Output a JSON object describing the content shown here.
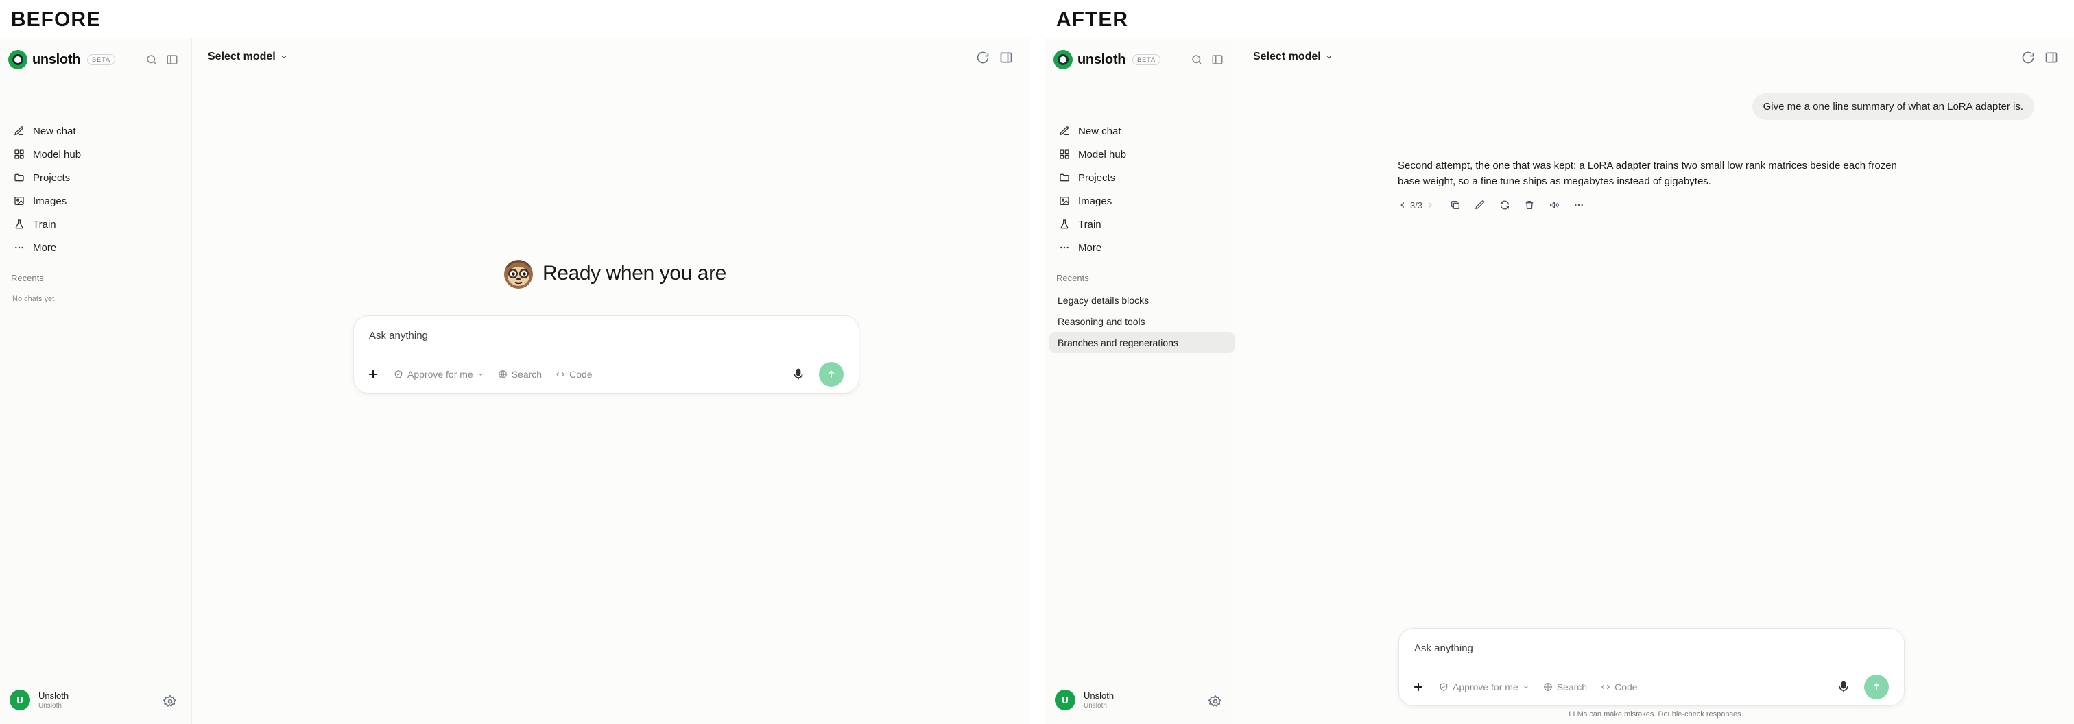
{
  "labels": {
    "before": "BEFORE",
    "after": "AFTER"
  },
  "brand": {
    "name": "unsloth",
    "badge": "BETA"
  },
  "nav": [
    {
      "label": "New chat",
      "icon": "edit-icon"
    },
    {
      "label": "Model hub",
      "icon": "grid-icon"
    },
    {
      "label": "Projects",
      "icon": "folder-icon"
    },
    {
      "label": "Images",
      "icon": "image-icon"
    },
    {
      "label": "Train",
      "icon": "flask-icon"
    },
    {
      "label": "More",
      "icon": "more-icon"
    }
  ],
  "recents": {
    "title": "Recents",
    "empty": "No chats yet",
    "items": [
      "Legacy details blocks",
      "Reasoning and tools",
      "Branches and regenerations"
    ],
    "active_index": 2
  },
  "user": {
    "initial": "U",
    "name": "Unsloth",
    "sub": "Unsloth"
  },
  "header": {
    "model_select": "Select model"
  },
  "hero": {
    "text": "Ready when you are"
  },
  "composer": {
    "placeholder": "Ask anything",
    "approve": "Approve for me",
    "search": "Search",
    "code": "Code"
  },
  "conversation": {
    "user_message": "Give me a one line summary of what an LoRA adapter is.",
    "assistant_message": "Second attempt, the one that was kept: a LoRA adapter trains two small low rank matrices beside each frozen base weight, so a fine tune ships as megabytes instead of gigabytes.",
    "branch_indicator": "3/3"
  },
  "disclaimer": "LLMs can make mistakes. Double-check responses.",
  "colors": {
    "accent": "#16a34a",
    "send_disabled": "#86d7ac",
    "active_item": "#ececea"
  }
}
